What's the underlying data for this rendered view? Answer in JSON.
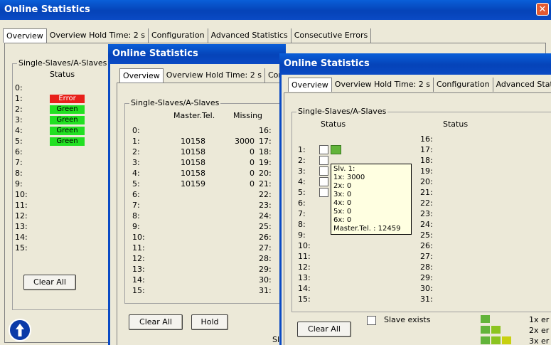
{
  "windows": {
    "back": {
      "title": "Online Statistics",
      "close_glyph": "✕",
      "tabs": [
        "Overview",
        "Overview  Hold Time: 2 s",
        "Configuration",
        "Advanced Statistics",
        "Consecutive Errors"
      ],
      "group_title": "Single-Slaves/A-Slaves",
      "status_header": "Status",
      "rows": [
        "0:",
        "1:",
        "2:",
        "3:",
        "4:",
        "5:",
        "6:",
        "7:",
        "8:",
        "9:",
        "10:",
        "11:",
        "12:",
        "13:",
        "14:",
        "15:"
      ],
      "badges": [
        {
          "row": 1,
          "text": "Error",
          "color": "#e8201a"
        },
        {
          "row": 2,
          "text": "Green",
          "color": "#22e022"
        },
        {
          "row": 3,
          "text": "Green",
          "color": "#22e022"
        },
        {
          "row": 4,
          "text": "Green",
          "color": "#22e022"
        },
        {
          "row": 5,
          "text": "Green",
          "color": "#22e022"
        }
      ],
      "clear_all": "Clear All",
      "info_icon": "arrow-up-circle-icon"
    },
    "middle": {
      "title": "Online Statistics",
      "tabs": [
        "Overview",
        "Overview  Hold Time: 2 s",
        "Configu"
      ],
      "group_title": "Single-Slaves/A-Slaves",
      "col_master": "Master.Tel.",
      "col_missing": "Missing",
      "rows_left": [
        "0:",
        "1:",
        "2:",
        "3:",
        "4:",
        "5:",
        "6:",
        "7:",
        "8:",
        "9:",
        "10:",
        "11:",
        "12:",
        "13:",
        "14:",
        "15:"
      ],
      "master": [
        "",
        "10158",
        "10158",
        "10158",
        "10158",
        "10159"
      ],
      "missing": [
        "",
        "3000",
        "0",
        "0",
        "0",
        "0"
      ],
      "rows_right": [
        "16:",
        "17:",
        "18:",
        "19:",
        "20:",
        "21:",
        "22:",
        "23:",
        "24:",
        "25:",
        "26:",
        "27:",
        "28:",
        "29:",
        "30:",
        "31:"
      ],
      "clear_all": "Clear All",
      "hold": "Hold",
      "footer_partial": "Slav"
    },
    "front": {
      "title": "Online Statistics",
      "tabs": [
        "Overview",
        "Overview  Hold Time: 2 s",
        "Configuration",
        "Advanced Statistics"
      ],
      "group_title": "Single-Slaves/A-Slaves",
      "status_header_left": "Status",
      "status_header_right": "Status",
      "rows_left": [
        "",
        "1:",
        "2:",
        "3:",
        "4:",
        "5:",
        "6:",
        "7:",
        "8:",
        "9:",
        "10:",
        "11:",
        "12:",
        "13:",
        "14:",
        "15:"
      ],
      "rows_right": [
        "16:",
        "17:",
        "18:",
        "19:",
        "20:",
        "21:",
        "22:",
        "23:",
        "24:",
        "25:",
        "26:",
        "27:",
        "28:",
        "29:",
        "30:",
        "31:"
      ],
      "tooltip": {
        "lines": [
          "Slv.  1:",
          "1x:  3000",
          "2x:  0",
          "3x:  0",
          "4x:  0",
          "5x:  0",
          "6x:  0",
          "Master.Tel. : 12459"
        ]
      },
      "clear_all": "Clear All",
      "legend_slave_exists": "Slave exists",
      "legend_1x": "1x er",
      "legend_2x": "2x er",
      "legend_3x": "3x er",
      "legend_colors": [
        "#62b43a",
        "#8cc420",
        "#c8d010"
      ]
    }
  }
}
